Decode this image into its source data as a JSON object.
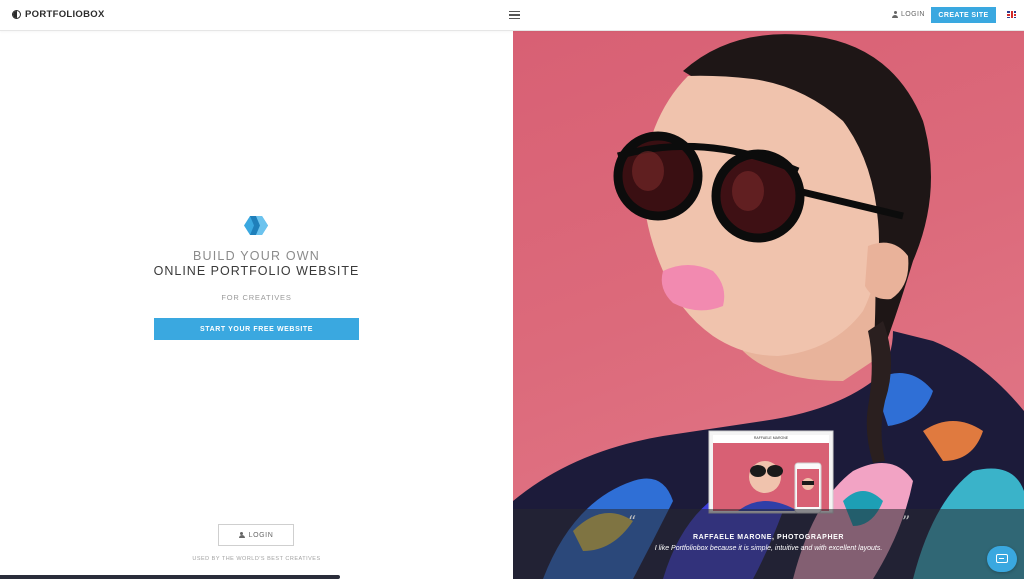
{
  "navbar": {
    "logo_text": "PORTFOLIOBOX",
    "login_label": "LOGIN",
    "create_site_label": "CREATE SITE",
    "language_flag": "uk-flag"
  },
  "hero_left": {
    "headline_line1": "BUILD YOUR OWN",
    "headline_line2": "ONLINE PORTFOLIO WEBSITE",
    "subheadline": "FOR CREATIVES",
    "cta_label": "START YOUR FREE WEBSITE",
    "login_label": "LOGIN",
    "footer_note": "USED BY THE WORLD'S BEST CREATIVES"
  },
  "hero_right": {
    "testimonial_name": "RAFFAELE MARONE, PHOTOGRAPHER",
    "testimonial_quote": "I like Portfoliobox because it is simple, intuitive and with excellent layouts.",
    "mockup_site_title": "RAFFAELE MARONE"
  },
  "colors": {
    "accent": "#3aa8e0",
    "hero_background": "#d86074"
  },
  "icons": [
    "portfoliobox-logo-icon",
    "hamburger-menu-icon",
    "user-icon",
    "uk-flag-icon",
    "brand-cube-icon",
    "chat-icon",
    "quote-open-icon",
    "quote-close-icon"
  ]
}
